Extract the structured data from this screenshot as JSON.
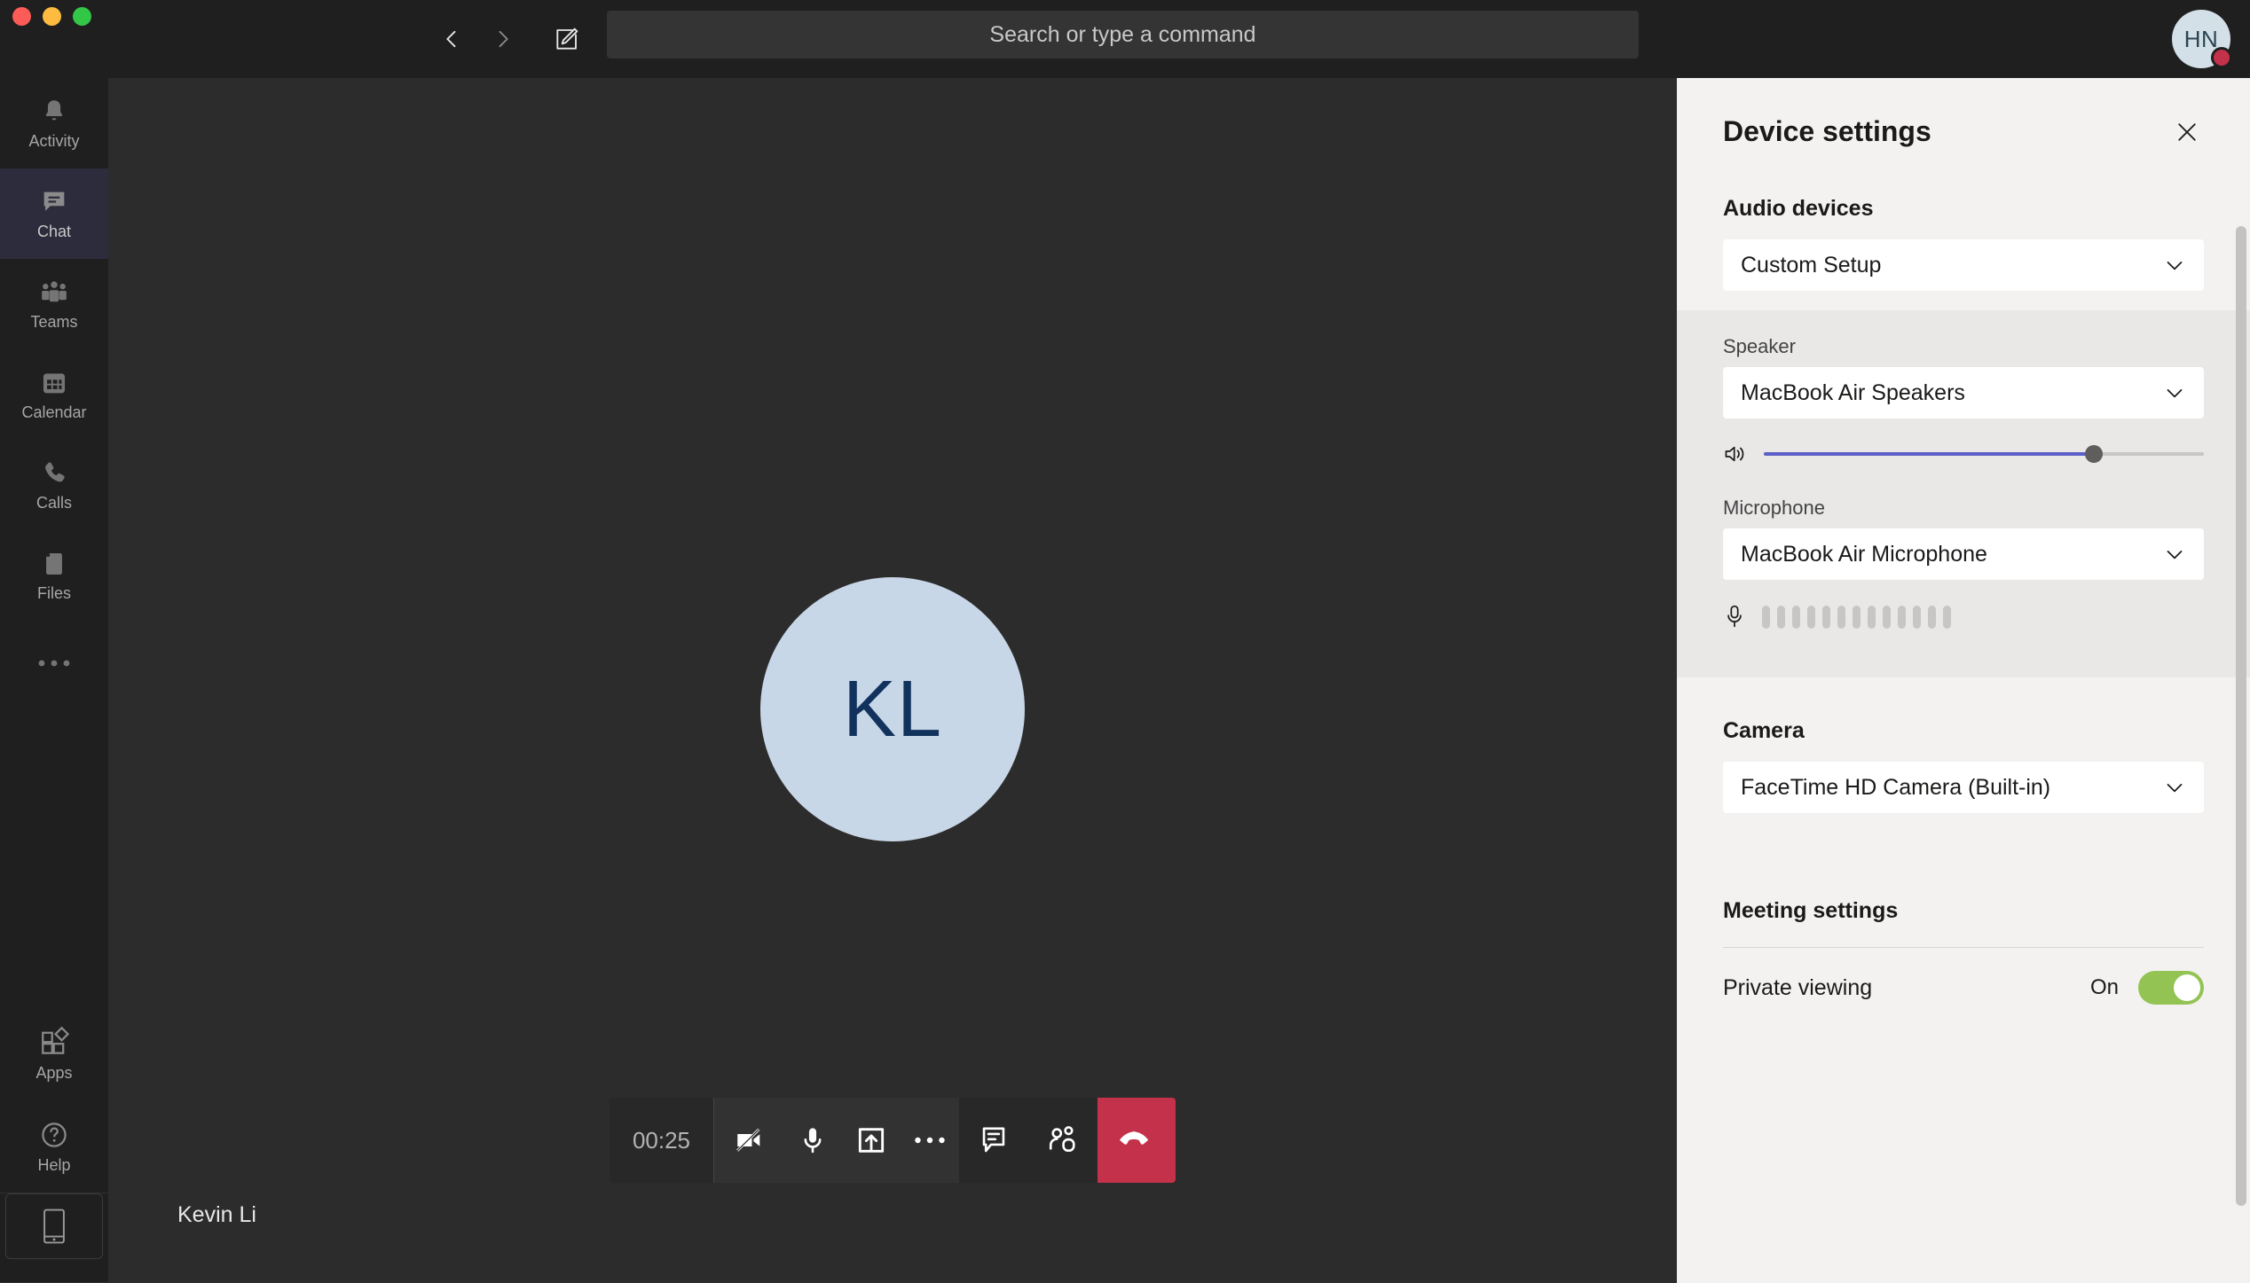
{
  "window": {
    "traffic_lights": [
      "close",
      "minimize",
      "maximize"
    ]
  },
  "topbar": {
    "back_label": "Back",
    "forward_label": "Forward",
    "compose_label": "New chat",
    "search_placeholder": "Search or type a command",
    "avatar_initials": "HN",
    "avatar_status": "busy",
    "status_color": "#c4314b"
  },
  "sidebar": {
    "items": [
      {
        "label": "Activity",
        "icon": "bell-icon",
        "active": false
      },
      {
        "label": "Chat",
        "icon": "chat-icon",
        "active": true
      },
      {
        "label": "Teams",
        "icon": "teams-icon",
        "active": false
      },
      {
        "label": "Calendar",
        "icon": "calendar-icon",
        "active": false
      },
      {
        "label": "Calls",
        "icon": "phone-icon",
        "active": false
      },
      {
        "label": "Files",
        "icon": "file-icon",
        "active": false
      },
      {
        "label": "",
        "icon": "more-horizontal-icon",
        "active": false
      }
    ],
    "bottom_items": [
      {
        "label": "Apps",
        "icon": "apps-icon"
      },
      {
        "label": "Help",
        "icon": "help-circle-icon"
      }
    ],
    "mobile_button_label": "Download the mobile app",
    "active_accent": "#2d2c3c"
  },
  "stage": {
    "participant_initials": "KL",
    "participant_name": "Kevin Li",
    "avatar_bg": "#c8d7e8",
    "avatar_fg": "#10325c",
    "background": "#2d2c2c"
  },
  "callbar": {
    "timer": "00:25",
    "buttons": [
      {
        "name": "camera",
        "label": "Turn camera on",
        "icon": "camera-off-icon",
        "state": "off"
      },
      {
        "name": "microphone",
        "label": "Mute",
        "icon": "microphone-icon",
        "state": "on"
      },
      {
        "name": "share",
        "label": "Share content",
        "icon": "share-screen-icon",
        "state": "off"
      },
      {
        "name": "more",
        "label": "More actions",
        "icon": "more-horizontal-icon",
        "state": "off"
      },
      {
        "name": "chat",
        "label": "Show conversation",
        "icon": "chat-bubble-icon",
        "state": "off"
      },
      {
        "name": "people",
        "label": "Show participants",
        "icon": "people-icon",
        "state": "off"
      }
    ],
    "hangup_label": "Hang up",
    "hangup_color": "#c4314b"
  },
  "panel": {
    "title": "Device settings",
    "close_label": "Close",
    "audio": {
      "heading": "Audio devices",
      "device_value": "Custom Setup",
      "speaker_label": "Speaker",
      "speaker_value": "MacBook Air Speakers",
      "volume_percent": 75,
      "volume_icon": "speaker-icon",
      "microphone_label": "Microphone",
      "microphone_value": "MacBook Air Microphone",
      "microphone_icon": "microphone-icon",
      "mic_level_bars": 13,
      "mic_level_active": 0,
      "slider_accent": "#5b5fc7"
    },
    "camera": {
      "heading": "Camera",
      "value": "FaceTime HD Camera (Built-in)"
    },
    "meeting": {
      "heading": "Meeting settings",
      "private_viewing_label": "Private viewing",
      "private_viewing_state": "On",
      "private_viewing_on": true,
      "toggle_on_color": "#92c353"
    }
  }
}
